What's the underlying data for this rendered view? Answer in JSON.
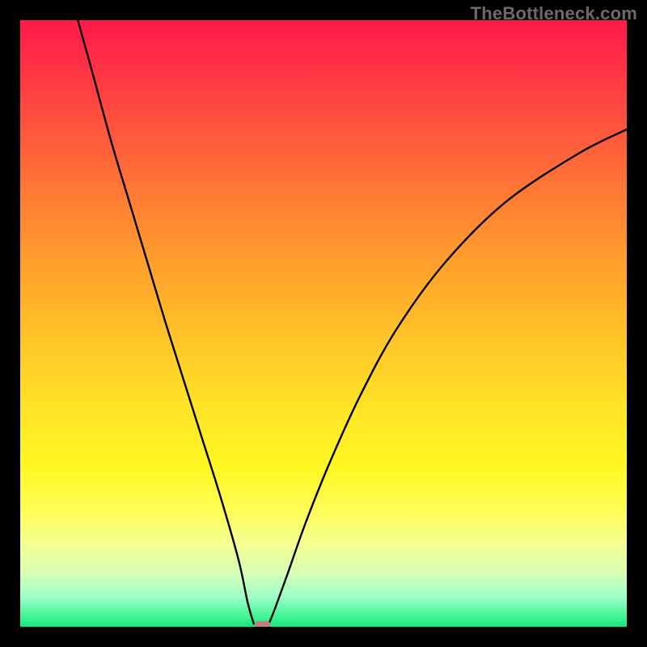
{
  "watermark": "TheBottleneck.com",
  "colors": {
    "curve_stroke": "#000000",
    "marker_fill": "#c97a7a",
    "frame_bg": "#000000"
  },
  "chart_data": {
    "type": "line",
    "title": "",
    "xlabel": "",
    "ylabel": "",
    "xlim": [
      0,
      100
    ],
    "ylim": [
      0,
      100
    ],
    "grid": false,
    "series": [
      {
        "name": "left-branch",
        "x": [
          9.5,
          12,
          15,
          18,
          21,
          24,
          27,
          30,
          33,
          36,
          37.5,
          38.5
        ],
        "y": [
          100,
          91,
          80,
          70,
          60,
          50,
          40.5,
          31,
          21.5,
          11,
          4,
          0.5
        ]
      },
      {
        "name": "right-branch",
        "x": [
          41,
          42,
          44,
          47,
          51,
          56,
          62,
          70,
          80,
          92,
          100
        ],
        "y": [
          0.5,
          3,
          8.5,
          17,
          27,
          38,
          49,
          60,
          70,
          78,
          82
        ]
      }
    ],
    "marker": {
      "x": 40,
      "y": 0.1,
      "shape": "rounded-rect",
      "color": "#c97a7a"
    },
    "background_gradient": [
      {
        "pos": 0.0,
        "hex": "#ff1a4a"
      },
      {
        "pos": 0.3,
        "hex": "#ff7f33"
      },
      {
        "pos": 0.65,
        "hex": "#ffe626"
      },
      {
        "pos": 0.88,
        "hex": "#e8ffae"
      },
      {
        "pos": 1.0,
        "hex": "#14e77e"
      }
    ]
  }
}
